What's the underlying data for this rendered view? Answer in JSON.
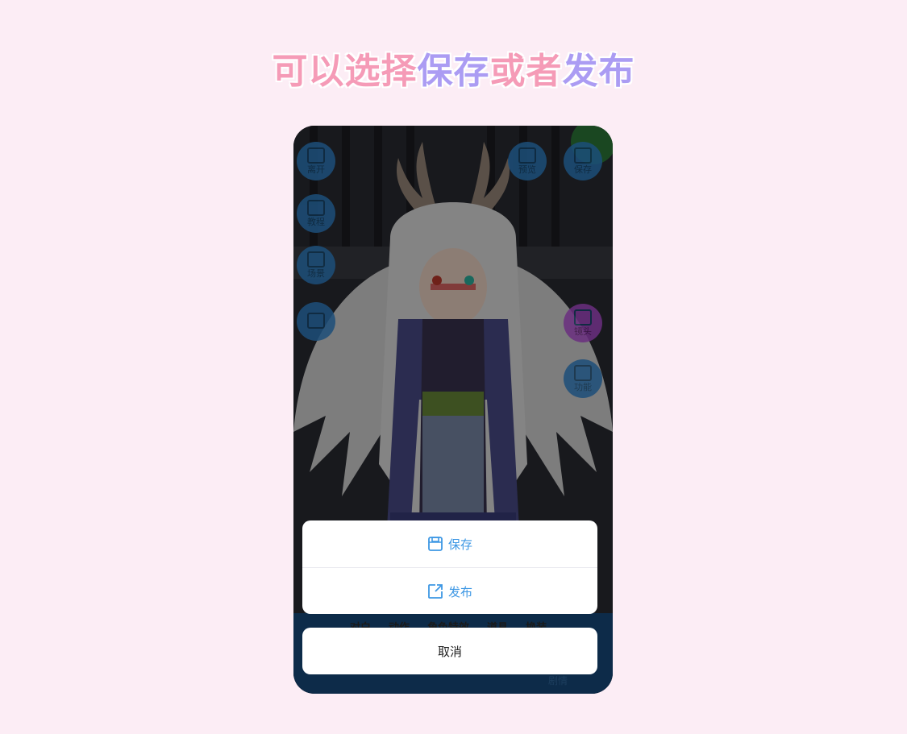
{
  "headline": {
    "part1": "可以选择",
    "part2": "保存",
    "part3": "或者",
    "part4": "发布"
  },
  "game": {
    "left_buttons": [
      {
        "label": "离开",
        "icon": "exit-icon"
      },
      {
        "label": "教程",
        "icon": "tutorial-icon"
      },
      {
        "label": "场景",
        "icon": "scene-icon"
      },
      {
        "label": "",
        "icon": "fullscreen-icon"
      }
    ],
    "top_right_buttons": [
      {
        "label": "预览",
        "icon": "play-icon"
      },
      {
        "label": "保存",
        "icon": "save-icon"
      }
    ],
    "right_buttons": [
      {
        "label": "镜头",
        "icon": "camera-icon"
      },
      {
        "label": "功能",
        "icon": "cube-icon"
      }
    ],
    "tabs": [
      "对白",
      "动作",
      "角色特效",
      "道具",
      "换装"
    ],
    "bottom_label": "剧情"
  },
  "sheet": {
    "save_label": "保存",
    "publish_label": "发布",
    "cancel_label": "取消"
  },
  "colors": {
    "accent_blue": "#3d97e4",
    "headline_pink": "#f59bb7",
    "headline_purple": "#ab9cf3"
  }
}
